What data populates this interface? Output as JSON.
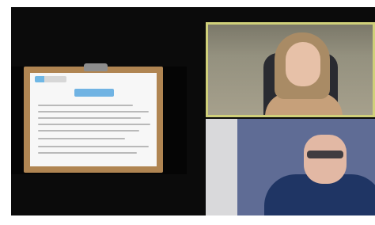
{
  "meeting": {
    "layout": "gallery-with-shared-screen",
    "participants_visible": 2
  },
  "shared_screen": {
    "content": "document slide",
    "brand_accent": "#70b3e3",
    "frame_color": "#b08552"
  },
  "participants": [
    {
      "id": "participant-1"
    },
    {
      "id": "participant-2"
    }
  ],
  "colors": {
    "stage_background": "#0b0b0b",
    "active_speaker_border": "#d0d07a",
    "page_background": "#ffffff"
  }
}
